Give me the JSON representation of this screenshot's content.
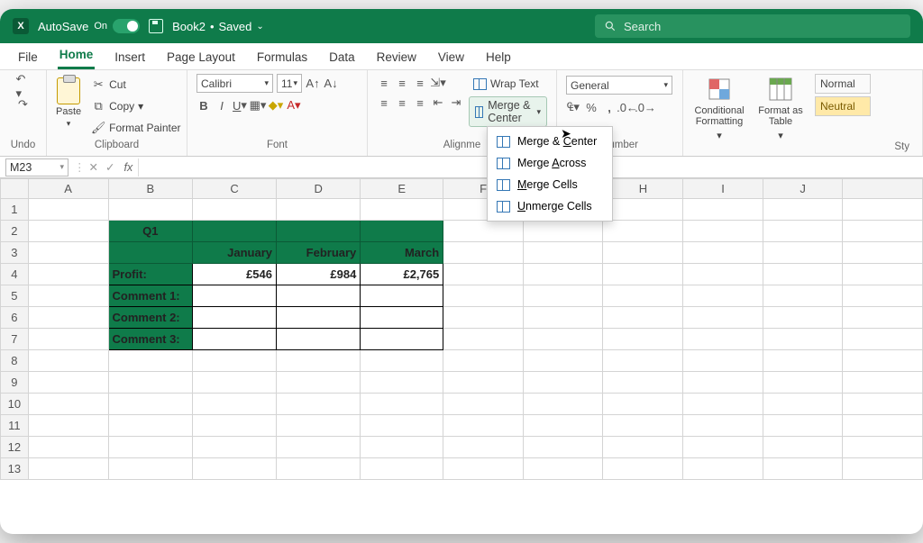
{
  "titlebar": {
    "autosave_label": "AutoSave",
    "autosave_state": "On",
    "doc_name": "Book2",
    "doc_state": "Saved",
    "search_placeholder": "Search"
  },
  "menu": {
    "tabs": [
      "File",
      "Home",
      "Insert",
      "Page Layout",
      "Formulas",
      "Data",
      "Review",
      "View",
      "Help"
    ],
    "active": "Home"
  },
  "ribbon": {
    "undo_label": "Undo",
    "clipboard": {
      "paste": "Paste",
      "cut": "Cut",
      "copy": "Copy",
      "painter": "Format Painter",
      "label": "Clipboard"
    },
    "font": {
      "name": "Calibri",
      "size": "11",
      "label": "Font"
    },
    "alignment": {
      "wrap": "Wrap Text",
      "merge": "Merge & Center",
      "label": "Alignme"
    },
    "number": {
      "format": "General",
      "label": "Number"
    },
    "styles": {
      "cond": "Conditional Formatting",
      "fmtas": "Format as Table",
      "normal": "Normal",
      "neutral": "Neutral",
      "label": "Sty"
    }
  },
  "merge_menu": {
    "items": [
      {
        "label": "Merge & ",
        "u": "C",
        "rest": "enter"
      },
      {
        "label": "Merge ",
        "u": "A",
        "rest": "cross"
      },
      {
        "label": "",
        "u": "M",
        "rest": "erge Cells"
      },
      {
        "label": "",
        "u": "U",
        "rest": "nmerge Cells"
      }
    ]
  },
  "fxbar": {
    "namebox": "M23",
    "fx": "fx"
  },
  "sheet": {
    "cols": [
      "A",
      "B",
      "C",
      "D",
      "E",
      "F",
      "",
      "H",
      "I",
      "J",
      ""
    ],
    "rows": 13,
    "content_start_row": 2,
    "title": "Q1",
    "months": [
      "January",
      "February",
      "March"
    ],
    "profit_label": "Profit:",
    "profit_values": [
      "£546",
      "£984",
      "£2,765"
    ],
    "comments": [
      "Comment 1:",
      "Comment 2:",
      "Comment 3:"
    ]
  }
}
